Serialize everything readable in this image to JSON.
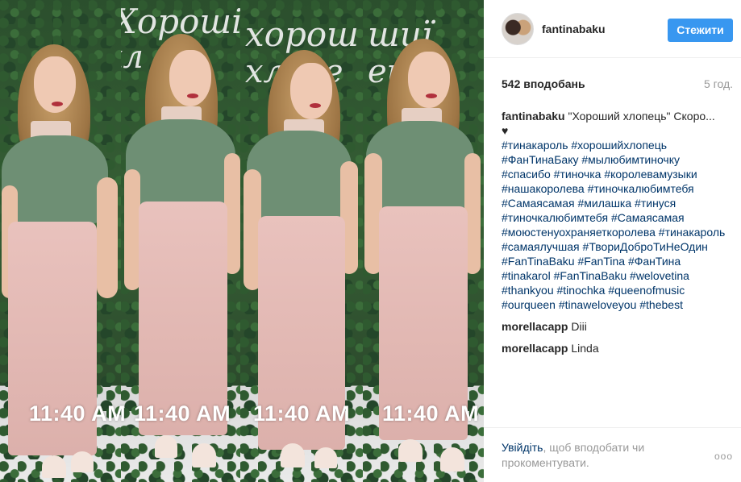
{
  "post": {
    "watermark_time": "11:40 AM"
  },
  "header": {
    "username": "fantinabaku",
    "follow_label": "Стежити"
  },
  "stats": {
    "likes": "542 вподобань",
    "age": "5 год."
  },
  "caption": {
    "author": "fantinabaku",
    "text": "\"Хороший хлопець\" Скоро...",
    "heart": "♥",
    "hashtags": [
      "#тинакароль",
      "#хорошийхлопець",
      "#ФанТинаБаку",
      "#мылюбимтиночку",
      "#спасибо",
      "#тиночка",
      "#королевамузыки",
      "#нашакоролева",
      "#тиночкалюбимтебя",
      "#Самаясамая",
      "#милашка",
      "#тинуся",
      "#тиночкалюбимтебя",
      "#Самаясамая",
      "#моюстенуохраняеткоролева",
      "#тинакароль",
      "#самаялучшая",
      "#ТвориДоброТиНеОдин",
      "#FanTinaBaku",
      "#FanTina",
      "#ФанТина",
      "#tinakarol",
      "#FanTinaBaku",
      "#welovetina",
      "#thankyou",
      "#tinochka",
      "#queenofmusic",
      "#ourqueen",
      "#tinaweloveyou",
      "#thebest"
    ]
  },
  "comments": [
    {
      "author": "morellacapp",
      "text": "Diii"
    },
    {
      "author": "morellacapp",
      "text": "Linda"
    }
  ],
  "footer": {
    "login_link": "Увійдіть",
    "login_rest": ", щоб вподобати чи прокоментувати.",
    "more": "ооо"
  }
}
